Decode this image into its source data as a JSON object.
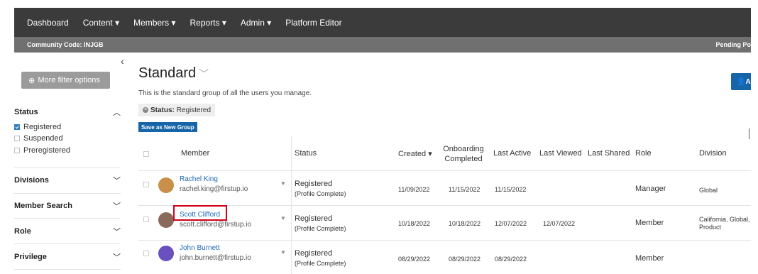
{
  "nav": {
    "items": [
      "Dashboard",
      "Content ▾",
      "Members ▾",
      "Reports ▾",
      "Admin ▾",
      "Platform Editor"
    ],
    "community_code": "Community Code: INJGB",
    "pending": "Pending Po"
  },
  "sidebar": {
    "collapse": "‹",
    "more_filter": "More filter options",
    "status_heading": "Status",
    "status_options": [
      "Registered",
      "Suspended",
      "Preregistered"
    ],
    "sections": [
      "Divisions",
      "Member Search",
      "Role",
      "Privilege"
    ]
  },
  "main": {
    "title": "Standard",
    "add_label": "Ad",
    "description": "This is the standard group of all the users you manage.",
    "filter_chip_label": "Status:",
    "filter_chip_value": "Registered",
    "save_group": "Save as New Group"
  },
  "table": {
    "headers": {
      "member": "Member",
      "status": "Status",
      "created": "Created ▾",
      "onboarding": "Onboarding Completed",
      "last_active": "Last Active",
      "last_viewed": "Last Viewed",
      "last_shared": "Last Shared",
      "role": "Role",
      "division": "Division"
    },
    "rows": [
      {
        "name": "Rachel King",
        "email": "rachel.king@firstup.io",
        "status": "Registered",
        "status_sub": "(Profile Complete)",
        "created": "11/09/2022",
        "onboarding": "11/15/2022",
        "last_active": "11/15/2022",
        "last_viewed": "",
        "last_shared": "",
        "role": "Manager",
        "division": "Global",
        "avatar_color": "#c8904a"
      },
      {
        "name": "Scott Clifford",
        "email": "scott.clifford@firstup.io",
        "status": "Registered",
        "status_sub": "(Profile Complete)",
        "created": "10/18/2022",
        "onboarding": "10/18/2022",
        "last_active": "12/07/2022",
        "last_viewed": "12/07/2022",
        "last_shared": "",
        "role": "Member",
        "division": "California, Global, Product",
        "avatar_color": "#8a6a5a"
      },
      {
        "name": "John Burnett",
        "email": "john.burnett@firstup.io",
        "status": "Registered",
        "status_sub": "(Profile Complete)",
        "created": "08/29/2022",
        "onboarding": "08/29/2022",
        "last_active": "08/29/2022",
        "last_viewed": "",
        "last_shared": "",
        "role": "Member",
        "division": "",
        "avatar_color": "#6a4fbf"
      }
    ]
  },
  "colors": {
    "accent": "#1565a8",
    "nav_bg": "#3b3b3b",
    "highlight": "#d0021b"
  }
}
